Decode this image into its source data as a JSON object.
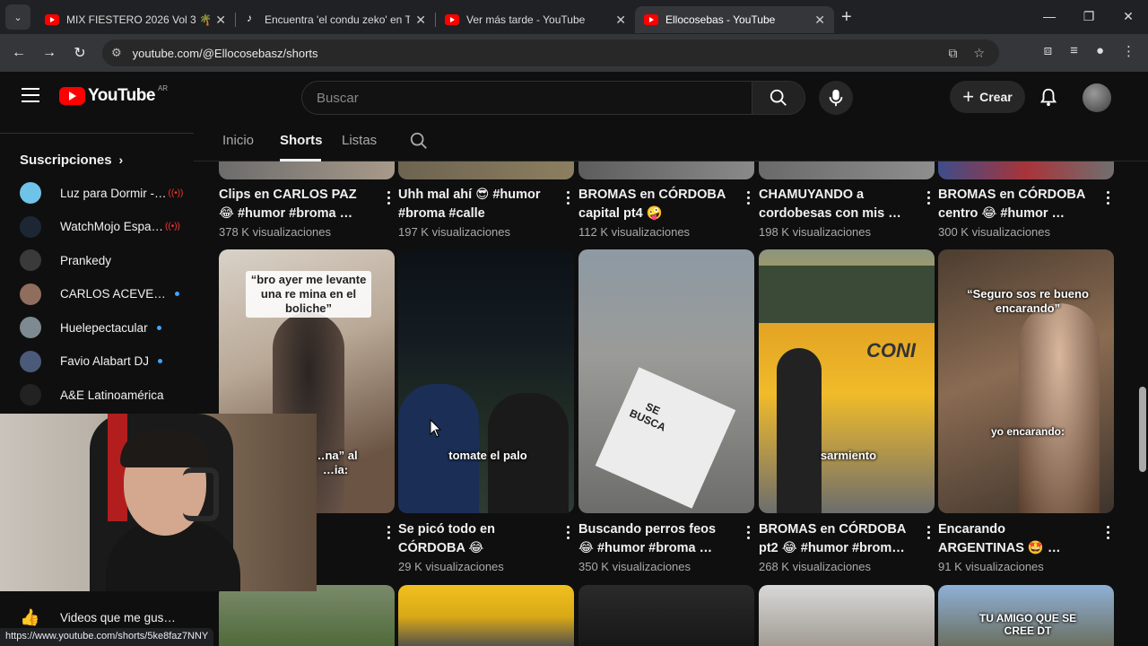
{
  "browser": {
    "tabs": [
      {
        "title": "MIX FIESTERO 2026 Vol 3 🌴🎉",
        "active": false,
        "favicon": "youtube"
      },
      {
        "title": "Encuentra 'el condu zeko' en TikTok",
        "active": false,
        "favicon": "tiktok"
      },
      {
        "title": "Ver más tarde - YouTube",
        "active": false,
        "favicon": "youtube"
      },
      {
        "title": "Ellocosebas - YouTube",
        "active": true,
        "favicon": "youtube"
      }
    ],
    "url": "youtube.com/@Ellocosebasz/shorts",
    "status_url": "https://www.youtube.com/shorts/5ke8faz7NNY"
  },
  "header": {
    "logo_text": "YouTube",
    "country_code": "AR",
    "search_placeholder": "Buscar",
    "create_label": "Crear"
  },
  "sidebar": {
    "subs_title": "Suscripciones",
    "subscriptions": [
      {
        "name": "Luz para Dormir -…",
        "color": "#6fc3e8",
        "badge": "live"
      },
      {
        "name": "WatchMojo Espa…",
        "color": "#1c2733",
        "badge": "live"
      },
      {
        "name": "Prankedy",
        "color": "#3a3a3a",
        "badge": "none"
      },
      {
        "name": "CARLOS ACEVE…",
        "color": "#8f6e5e",
        "badge": "dot"
      },
      {
        "name": "Huelepectacular",
        "color": "#7d8a91",
        "badge": "dot"
      },
      {
        "name": "Favio Alabart DJ",
        "color": "#4a5a78",
        "badge": "dot"
      },
      {
        "name": "A&E Latinoamérica",
        "color": "#222222",
        "badge": "none"
      }
    ],
    "liked_label": "Videos que me gus…"
  },
  "channel_tabs": [
    "Inicio",
    "Shorts",
    "Listas"
  ],
  "active_tab": "Shorts",
  "row1": [
    {
      "title": "Clips en CARLOS PAZ 😂 #humor #broma …",
      "views": "378 K visualizaciones"
    },
    {
      "title": "Uhh mal ahí 😎 #humor #broma #calle",
      "views": "197 K visualizaciones"
    },
    {
      "title": "BROMAS en CÓRDOBA capital pt4 🤪 #humor…",
      "views": "112 K visualizaciones"
    },
    {
      "title": "CHAMUYANDO a cordobesas con mis …",
      "views": "198 K visualizaciones"
    },
    {
      "title": "BROMAS en CÓRDOBA centro 😂 #humor …",
      "views": "300 K visualizaciones"
    }
  ],
  "row2": [
    {
      "title": "…a …or …",
      "views": "…s",
      "caption_top": "“bro ayer me levante una re mina en el boliche”",
      "caption_mid": "…na” al …ia:"
    },
    {
      "title": "Se picó todo en CÓRDOBA 😂 #humor…",
      "views": "29 K visualizaciones",
      "caption_mid": "tomate el palo"
    },
    {
      "title": "Buscando perros feos 😂 #humor #broma …",
      "views": "350 K visualizaciones",
      "caption_mid": "SE BUSCA"
    },
    {
      "title": "BROMAS en CÓRDOBA pt2 😂 #humor #brom…",
      "views": "268 K visualizaciones",
      "caption_mid": "sarmiento",
      "bus_text": "CONI"
    },
    {
      "title": "Encarando ARGENTINAS 🤩 …",
      "views": "91 K visualizaciones",
      "caption_top": "“Seguro sos re bueno encarando”",
      "caption_mid": "yo encarando:"
    }
  ],
  "row3_captions": {
    "last": "TU AMIGO QUE SE CREE DT"
  }
}
